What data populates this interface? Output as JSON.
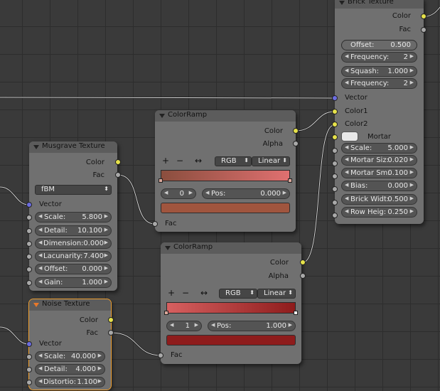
{
  "brick": {
    "title": "Brick Texture",
    "out_color": "Color",
    "out_fac": "Fac",
    "offset_label": "Offset:",
    "offset_value": "0.500",
    "freq1_label": "Frequency:",
    "freq1_value": "2",
    "squash_label": "Squash:",
    "squash_value": "1.000",
    "freq2_label": "Frequency:",
    "freq2_value": "2",
    "in_vector": "Vector",
    "in_color1": "Color1",
    "in_color2": "Color2",
    "mortar_label": "Mortar",
    "scale_label": "Scale:",
    "scale_value": "5.000",
    "mortar_size_label": "Mortar Siz:",
    "mortar_size_value": "0.020",
    "mortar_smooth_label": "Mortar Sm:",
    "mortar_smooth_value": "0.100",
    "bias_label": "Bias:",
    "bias_value": "0.000",
    "brick_width_label": "Brick Widt:",
    "brick_width_value": "0.500",
    "row_height_label": "Row Heig:",
    "row_height_value": "0.250"
  },
  "ramp1": {
    "title": "ColorRamp",
    "out_color": "Color",
    "out_alpha": "Alpha",
    "add": "+",
    "remove": "−",
    "flip": "↔",
    "mode": "RGB",
    "interp": "Linear",
    "index": "0",
    "pos_label": "Pos:",
    "pos_value": "0.000",
    "in_fac": "Fac",
    "grad_start": "#8a4e3e",
    "grad_end": "#e07070",
    "swatch_color": "#a0553e"
  },
  "ramp2": {
    "title": "ColorRamp",
    "out_color": "Color",
    "out_alpha": "Alpha",
    "add": "+",
    "remove": "−",
    "flip": "↔",
    "mode": "RGB",
    "interp": "Linear",
    "index": "1",
    "pos_label": "Pos:",
    "pos_value": "1.000",
    "in_fac": "Fac",
    "grad_start": "#d76060",
    "grad_end": "#8e1c1c",
    "swatch_color": "#8e1c1c"
  },
  "musgrave": {
    "title": "Musgrave Texture",
    "out_color": "Color",
    "out_fac": "Fac",
    "type": "fBM",
    "in_vector": "Vector",
    "scale_label": "Scale:",
    "scale_value": "5.800",
    "detail_label": "Detail:",
    "detail_value": "10.100",
    "dimension_label": "Dimension:",
    "dimension_value": "0.000",
    "lacunarity_label": "Lacunarity:",
    "lacunarity_value": "7.400",
    "offset_label": "Offset:",
    "offset_value": "0.000",
    "gain_label": "Gain:",
    "gain_value": "1.000"
  },
  "noise": {
    "title": "Noise Texture",
    "out_color": "Color",
    "out_fac": "Fac",
    "in_vector": "Vector",
    "scale_label": "Scale:",
    "scale_value": "40.000",
    "detail_label": "Detail:",
    "detail_value": "4.000",
    "distortion_label": "Distortio:",
    "distortion_value": "1.100"
  },
  "colors": {
    "socket_color": "#e6e24a",
    "socket_value": "#a9a9a9",
    "socket_vector": "#6b6ce0",
    "active_outline": "#f0a030"
  }
}
